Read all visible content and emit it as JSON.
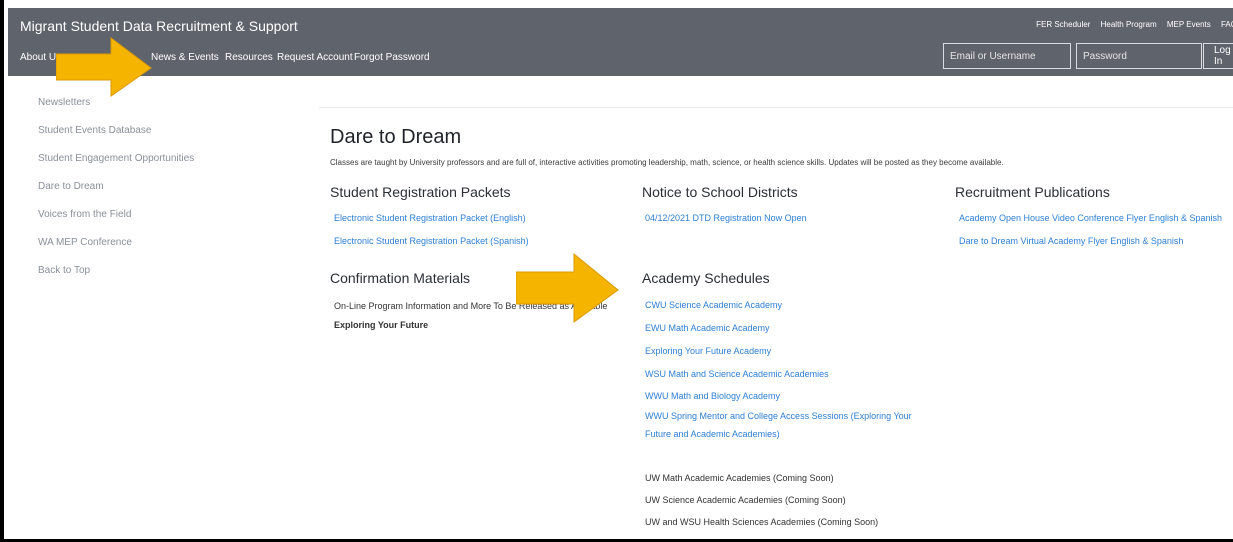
{
  "header": {
    "site_title": "Migrant Student Data Recruitment & Support",
    "top_links": [
      "FER Scheduler",
      "Health Program",
      "MEP Events",
      "FAQ"
    ],
    "nav": {
      "about": "About U",
      "news_events": "News & Events",
      "resources": "Resources",
      "request_account": "Request Account",
      "forgot_password": "Forgot Password"
    },
    "login": {
      "email_placeholder": "Email or Username",
      "password_placeholder": "Password",
      "button_label": "Log In"
    }
  },
  "sidebar": {
    "items": [
      "Newsletters",
      "Student Events Database",
      "Student Engagement Opportunities",
      "Dare to Dream",
      "Voices from the Field",
      "WA MEP Conference",
      "Back to Top"
    ]
  },
  "main": {
    "title": "Dare to Dream",
    "intro": "Classes are taught by University professors and are full of, interactive activities promoting leadership, math, science, or health science skills. Updates will be posted as they become available.",
    "student_registration": {
      "heading": "Student Registration Packets",
      "links": [
        "Electronic Student Registration Packet (English)",
        "Electronic Student Registration Packet (Spanish)"
      ]
    },
    "notice": {
      "heading": "Notice to School Districts",
      "links": [
        "04/12/2021 DTD Registration Now Open"
      ]
    },
    "recruitment": {
      "heading": "Recruitment Publications",
      "links": [
        "Academy Open House Video Conference Flyer English & Spanish",
        "Dare to Dream Virtual Academy Flyer English & Spanish"
      ]
    },
    "confirmation": {
      "heading": "Confirmation Materials",
      "text": "On-Line Program Information and More To Be Released as Available",
      "bold_text": "Exploring Your Future"
    },
    "academy": {
      "heading": "Academy Schedules",
      "links": [
        "CWU Science Academic Academy",
        "EWU Math Academic Academy",
        "Exploring Your Future Academy",
        "WSU Math and Science Academic Academies",
        "WWU Math and Biology Academy",
        "WWU Spring Mentor and College Access Sessions (Exploring Your",
        "Future and Academic Academies)"
      ],
      "coming_soon": [
        "UW Math Academic Academies (Coming Soon)",
        "UW Science Academic Academies (Coming Soon)",
        "UW and WSU Health Sciences Academies (Coming Soon)"
      ]
    }
  },
  "colors": {
    "header_bg": "#5f636c",
    "link": "#2d7fd6",
    "arrow": "#f5b400"
  },
  "annotations": {
    "arrows": [
      "arrow-pointing-news-events",
      "arrow-pointing-academy-schedules"
    ]
  }
}
